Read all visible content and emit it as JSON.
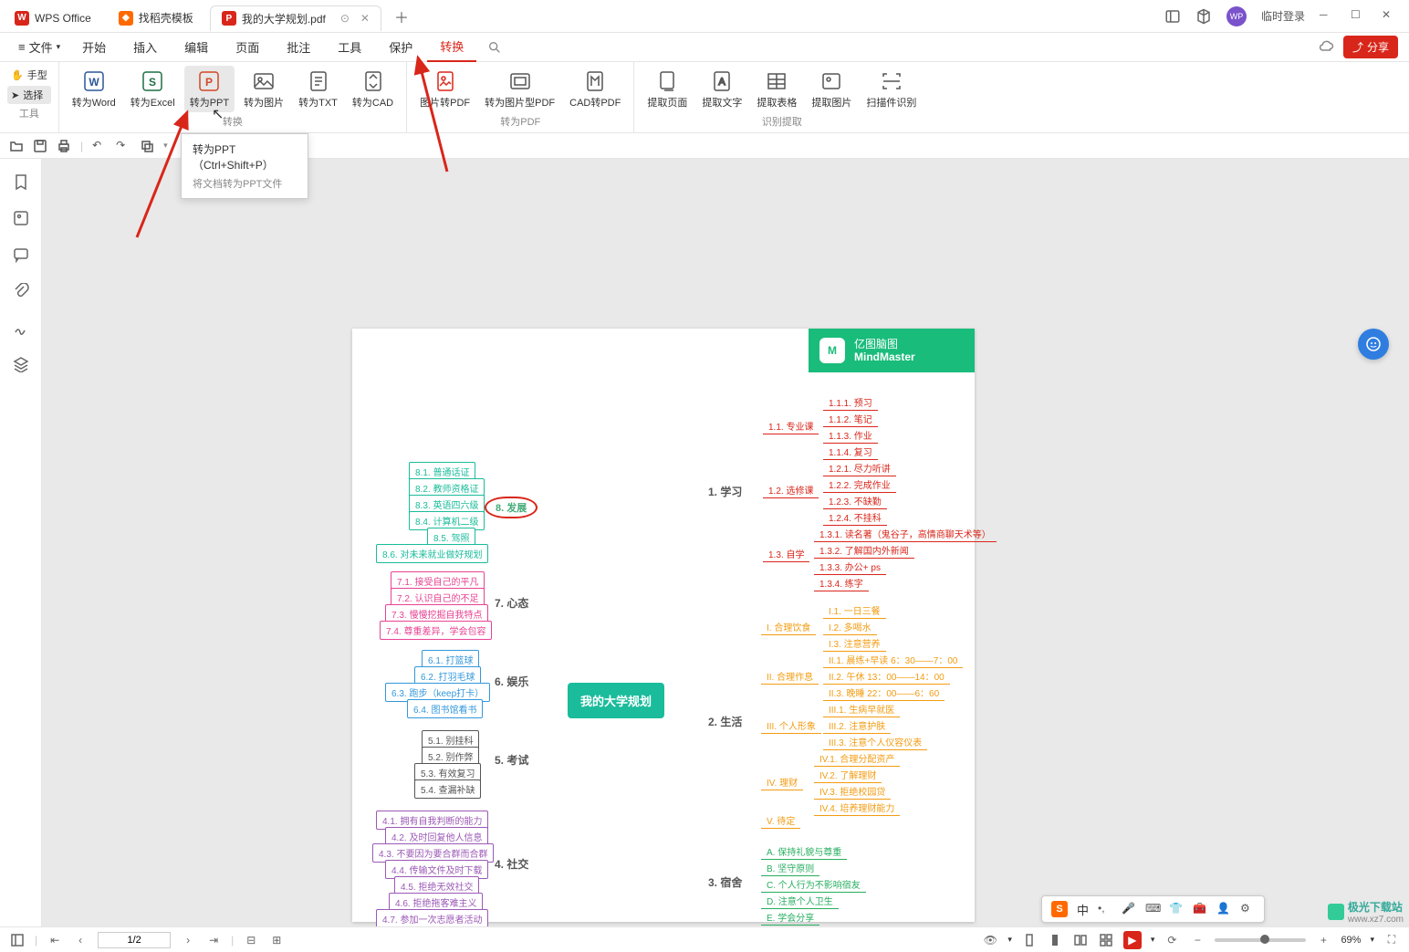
{
  "titlebar": {
    "app_name": "WPS Office",
    "tab_docer": "找稻壳模板",
    "tab_doc": "我的大学规划.pdf",
    "login": "临时登录"
  },
  "menubar": {
    "file": "文件",
    "items": [
      "开始",
      "插入",
      "编辑",
      "页面",
      "批注",
      "工具",
      "保护",
      "转换"
    ]
  },
  "ribbon": {
    "tools": {
      "hand": "手型",
      "select": "选择",
      "group_label": "工具"
    },
    "convert_to": {
      "word": "转为Word",
      "excel": "转为Excel",
      "ppt": "转为PPT",
      "image": "转为图片",
      "txt": "转为TXT",
      "cad": "转为CAD",
      "group_label": "转换"
    },
    "to_pdf": {
      "img2pdf": "图片转PDF",
      "img_type_pdf": "转为图片型PDF",
      "cad2pdf": "CAD转PDF",
      "group_label": "转为PDF"
    },
    "extract": {
      "page": "提取页面",
      "text": "提取文字",
      "table": "提取表格",
      "image": "提取图片",
      "scan": "扫描件识别",
      "group_label": "识别提取"
    }
  },
  "tooltip": {
    "title": "转为PPT（Ctrl+Shift+P）",
    "desc": "将文档转为PPT文件"
  },
  "mindmap": {
    "brand_top": "亿图脑图",
    "brand_bottom": "MindMaster",
    "center": "我的大学规划",
    "right_mains": [
      "1. 学习",
      "2. 生活",
      "3. 宿舍"
    ],
    "left_mains": [
      "8. 发展",
      "7. 心态",
      "6. 娱乐",
      "5. 考试",
      "4. 社交"
    ],
    "r1_sub": [
      "1.1. 专业课",
      "1.2. 选修课",
      "1.3. 自学"
    ],
    "r1_leaf": [
      "1.1.1. 预习",
      "1.1.2. 笔记",
      "1.1.3. 作业",
      "1.1.4. 复习",
      "1.2.1. 尽力听讲",
      "1.2.2. 完成作业",
      "1.2.3. 不缺勤",
      "1.2.4. 不挂科",
      "1.3.1. 读名著（鬼谷子，高情商聊天术等）",
      "1.3.2. 了解国内外新闻",
      "1.3.3. 办公+ ps",
      "1.3.4. 练字"
    ],
    "r2_sub": [
      "I. 合理饮食",
      "II. 合理作息",
      "III. 个人形象",
      "IV. 理财",
      "V. 待定"
    ],
    "r2_leaf": [
      "I.1. 一日三餐",
      "I.2. 多喝水",
      "I.3. 注意营养",
      "II.1. 晨练+早读 6：30——7：00",
      "II.2. 午休 13：00——14：00",
      "II.3. 晚睡 22：00——6：60",
      "III.1. 生病早就医",
      "III.2. 注意护肤",
      "III.3. 注意个人仪容仪表",
      "IV.1. 合理分配资产",
      "IV.2. 了解理财",
      "IV.3. 拒绝校园贷",
      "IV.4. 培养理财能力"
    ],
    "r3_leaf": [
      "A. 保持礼貌与尊重",
      "B. 坚守原则",
      "C. 个人行为不影响宿友",
      "D. 注意个人卫生",
      "E. 学会分享"
    ],
    "l8": [
      "8.1. 普通话证",
      "8.2. 教师资格证",
      "8.3. 英语四六级",
      "8.4. 计算机二级",
      "8.5. 驾照",
      "8.6. 对未来就业做好规划"
    ],
    "l7": [
      "7.1. 接受自己的平凡",
      "7.2. 认识自己的不足",
      "7.3. 慢慢挖掘自我特点",
      "7.4. 尊重差异，学会包容"
    ],
    "l6": [
      "6.1. 打篮球",
      "6.2. 打羽毛球",
      "6.3. 跑步（keep打卡）",
      "6.4. 图书馆看书"
    ],
    "l5": [
      "5.1. 别挂科",
      "5.2. 别作弊",
      "5.3. 有效复习",
      "5.4. 查漏补缺"
    ],
    "l4": [
      "4.1. 拥有自我判断的能力",
      "4.2. 及时回复他人信息",
      "4.3. 不要因为要合群而合群",
      "4.4. 传输文件及时下载",
      "4.5. 拒绝无效社交",
      "4.6. 拒绝拖客难主义",
      "4.7. 参加一次志愿者活动"
    ]
  },
  "ime": {
    "lang": "中"
  },
  "statusbar": {
    "page": "1/2",
    "zoom": "69%"
  },
  "watermark": {
    "name": "极光下载站",
    "url": "www.xz7.com"
  }
}
